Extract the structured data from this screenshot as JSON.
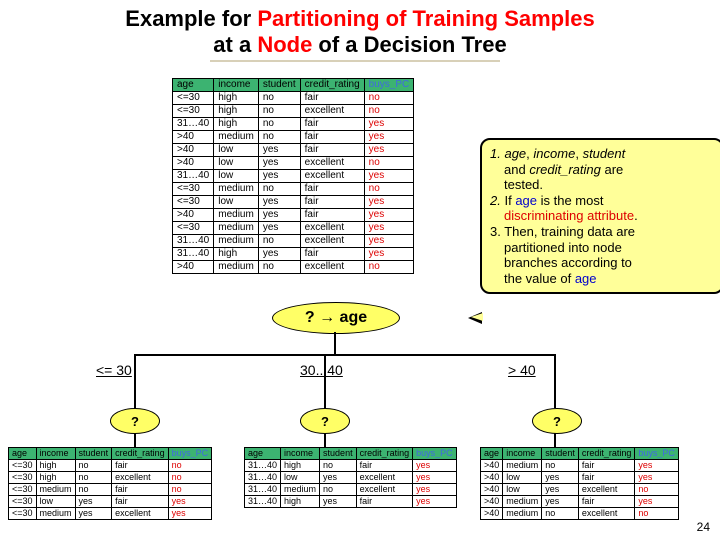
{
  "title": {
    "prefix": "Example for ",
    "red1": "Partitioning of Training Samples",
    "line2a": "at a ",
    "red2": "Node",
    "line2b": " of a Decision Tree"
  },
  "headers": [
    "age",
    "income",
    "student",
    "credit_rating",
    "buys_PC"
  ],
  "main_rows": [
    [
      "<=30",
      "high",
      "no",
      "fair",
      "no"
    ],
    [
      "<=30",
      "high",
      "no",
      "excellent",
      "no"
    ],
    [
      "31…40",
      "high",
      "no",
      "fair",
      "yes"
    ],
    [
      ">40",
      "medium",
      "no",
      "fair",
      "yes"
    ],
    [
      ">40",
      "low",
      "yes",
      "fair",
      "yes"
    ],
    [
      ">40",
      "low",
      "yes",
      "excellent",
      "no"
    ],
    [
      "31…40",
      "low",
      "yes",
      "excellent",
      "yes"
    ],
    [
      "<=30",
      "medium",
      "no",
      "fair",
      "no"
    ],
    [
      "<=30",
      "low",
      "yes",
      "fair",
      "yes"
    ],
    [
      ">40",
      "medium",
      "yes",
      "fair",
      "yes"
    ],
    [
      "<=30",
      "medium",
      "yes",
      "excellent",
      "yes"
    ],
    [
      "31…40",
      "medium",
      "no",
      "excellent",
      "yes"
    ],
    [
      "31…40",
      "high",
      "yes",
      "fair",
      "yes"
    ],
    [
      ">40",
      "medium",
      "no",
      "excellent",
      "no"
    ]
  ],
  "branch_left": {
    "label": "<= 30",
    "rows": [
      [
        "<=30",
        "high",
        "no",
        "fair",
        "no"
      ],
      [
        "<=30",
        "high",
        "no",
        "excellent",
        "no"
      ],
      [
        "<=30",
        "medium",
        "no",
        "fair",
        "no"
      ],
      [
        "<=30",
        "low",
        "yes",
        "fair",
        "yes"
      ],
      [
        "<=30",
        "medium",
        "yes",
        "excellent",
        "yes"
      ]
    ]
  },
  "branch_mid": {
    "label": "30.. 40",
    "rows": [
      [
        "31…40",
        "high",
        "no",
        "fair",
        "yes"
      ],
      [
        "31…40",
        "low",
        "yes",
        "excellent",
        "yes"
      ],
      [
        "31…40",
        "medium",
        "no",
        "excellent",
        "yes"
      ],
      [
        "31…40",
        "high",
        "yes",
        "fair",
        "yes"
      ]
    ]
  },
  "branch_right": {
    "label": "> 40",
    "rows": [
      [
        ">40",
        "medium",
        "no",
        "fair",
        "yes"
      ],
      [
        ">40",
        "low",
        "yes",
        "fair",
        "yes"
      ],
      [
        ">40",
        "low",
        "yes",
        "excellent",
        "no"
      ],
      [
        ">40",
        "medium",
        "yes",
        "fair",
        "yes"
      ],
      [
        ">40",
        "medium",
        "no",
        "excellent",
        "no"
      ]
    ]
  },
  "root_bubble": "? → age",
  "q_bubble": "?",
  "callout": {
    "l1a": "1. ",
    "l1b": "age",
    "l1c": ", ",
    "l1d": "income",
    "l1e": ", ",
    "l1f": "student",
    "l2a": "and ",
    "l2b": "credit_rating ",
    "l2c": "are",
    "l3": "tested.",
    "l4a": "2. ",
    "l4b": "If ",
    "l4c": "age ",
    "l4d": "is the most",
    "l5": "discriminating attribute",
    "l5dot": ".",
    "l6": "3. Then, training data are",
    "l7": "partitioned into node",
    "l8": "branches according to",
    "l9a": "the value of ",
    "l9b": "age"
  },
  "page_number": "24"
}
